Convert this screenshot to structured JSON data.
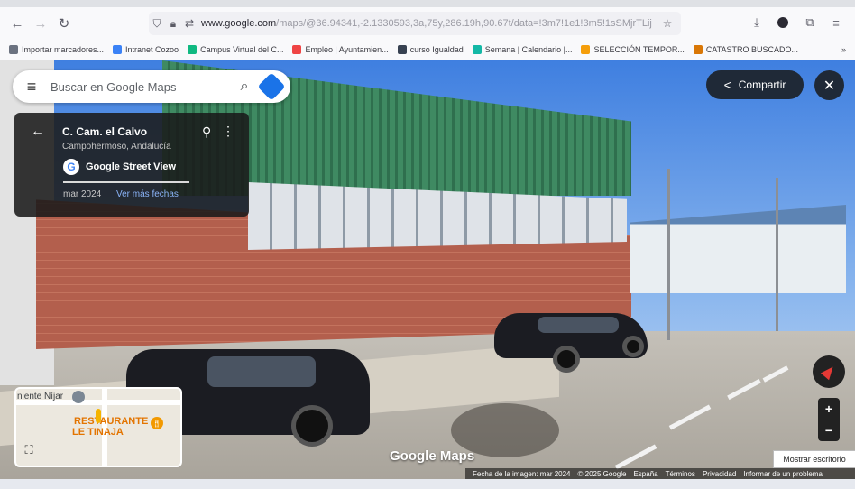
{
  "browser": {
    "url_host": "www.google.com",
    "url_path": "/maps/@36.94341,-2.1330593,3a,75y,286.19h,90.67t/data=!3m7!1e1!3m5!1sSMjrTLij",
    "bookmarks": [
      {
        "label": "Importar marcadores...",
        "color": "#6b7280"
      },
      {
        "label": "Intranet Cozoo",
        "color": "#3b82f6"
      },
      {
        "label": "Campus Virtual del C...",
        "color": "#10b981"
      },
      {
        "label": "Empleo | Ayuntamien...",
        "color": "#ef4444"
      },
      {
        "label": "curso Igualdad",
        "color": "#374151"
      },
      {
        "label": "Semana | Calendario |...",
        "color": "#14b8a6"
      },
      {
        "label": "SELECCIÓN TEMPOR...",
        "color": "#f59e0b"
      },
      {
        "label": "CATASTRO BUSCADO...",
        "color": "#d97706"
      }
    ]
  },
  "search": {
    "placeholder": "Buscar en Google Maps"
  },
  "info_card": {
    "title": "C. Cam. el Calvo",
    "subtitle": "Campohermoso, Andalucía",
    "source": "Google Street View",
    "date": "mar 2024",
    "more_dates": "Ver más fechas"
  },
  "share": {
    "label": "Compartir"
  },
  "minimap": {
    "place_label": "niente Níjar",
    "restaurant_line1": "RESTAURANTE",
    "restaurant_line2": "LE TINAJA"
  },
  "logo": "Google Maps",
  "footer": {
    "image_date": "Fecha de la imagen: mar 2024",
    "copyright": "© 2025 Google",
    "country": "España",
    "terms": "Términos",
    "privacy": "Privacidad",
    "report": "Informar de un problema"
  },
  "tooltip": "Mostrar escritorio"
}
